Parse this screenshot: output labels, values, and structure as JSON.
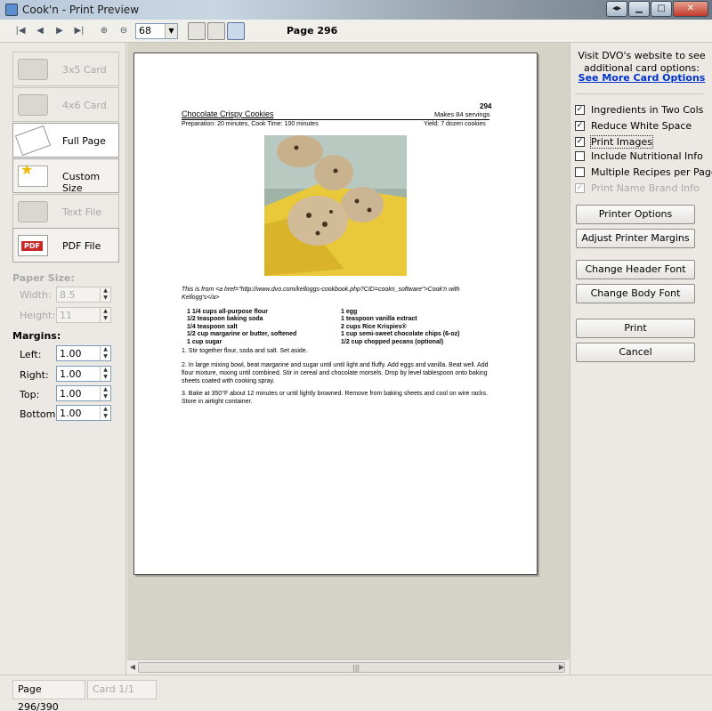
{
  "window": {
    "title": "Cook'n - Print Preview"
  },
  "toolbar": {
    "zoom_value": "68",
    "page_indicator": "Page 296"
  },
  "left_panel": {
    "card_options": [
      {
        "label": "3x5 Card",
        "enabled": false
      },
      {
        "label": "4x6 Card",
        "enabled": false
      },
      {
        "label": "Full Page",
        "enabled": true,
        "selected": true
      },
      {
        "label": "Custom Size",
        "enabled": true
      },
      {
        "label": "Text File",
        "enabled": false
      },
      {
        "label": "PDF File",
        "enabled": true
      }
    ],
    "pdf_badge": "PDF",
    "paper_size_label": "Paper Size:",
    "width_label": "Width:",
    "width_value": "8.5",
    "height_label": "Height:",
    "height_value": "11",
    "margins_label": "Margins:",
    "left_label": "Left:",
    "left_value": "1.00",
    "right_label": "Right:",
    "right_value": "1.00",
    "top_label": "Top:",
    "top_value": "1.00",
    "bottom_label": "Bottom:",
    "bottom_value": "1.00"
  },
  "recipe": {
    "page_number": "294",
    "title": "Chocolate Crispy Cookies",
    "makes": "Makes 84 servings",
    "prep": "Preparation: 20 minutes, Cook Time: 100 minutes",
    "yield": "Yield: 7 dozen cookies",
    "source": "This is from <a href=\"http://www.dvo.com/kelloggs-cookbook.php?CID=cookn_software\">Cook'n with Kellogg's</a>",
    "ingredients_left": [
      "1 1/4 cups all-purpose flour",
      "1/2 teaspoon baking soda",
      "1/4 teaspoon salt",
      "1/2 cup margarine or butter, softened",
      "1 cup sugar"
    ],
    "ingredients_right": [
      "1 egg",
      "1 teaspoon vanilla extract",
      "2 cups Rice Krispies®",
      "1 cup semi-sweet chocolate chips (6-oz)",
      "1/2 cup chopped pecans (optional)"
    ],
    "steps": [
      "1. Stir together flour, soda and salt. Set aside.",
      "2. In large mixing bowl, beat margarine and sugar until until light and fluffy. Add eggs and vanilla. Beat well. Add flour mixture, mixing until combined. Stir in cereal and chocolate morsels. Drop by level tablespoon onto baking sheets coated with cooking spray.",
      "3. Bake at 350°F about 12 minutes or until lightly browned. Remove from baking sheets and cool on wire racks. Store in airtight container."
    ]
  },
  "right_panel": {
    "visit_text": "Visit DVO's website to see additional card options:",
    "link_text": "See More Card Options",
    "checkboxes": [
      {
        "label": "Ingredients in Two Cols",
        "checked": true
      },
      {
        "label": "Reduce White Space",
        "checked": true
      },
      {
        "label": "Print Images",
        "checked": true
      },
      {
        "label": "Include Nutritional Info",
        "checked": false
      },
      {
        "label": "Multiple Recipes per Page",
        "checked": false
      },
      {
        "label": "Print Name Brand Info",
        "checked": true,
        "disabled": true
      }
    ],
    "printer_options": "Printer Options",
    "adjust_margins": "Adjust Printer Margins",
    "change_header_font": "Change Header Font",
    "change_body_font": "Change Body Font",
    "print": "Print",
    "cancel": "Cancel"
  },
  "status": {
    "page": "Page 296/390",
    "card": "Card 1/1"
  }
}
